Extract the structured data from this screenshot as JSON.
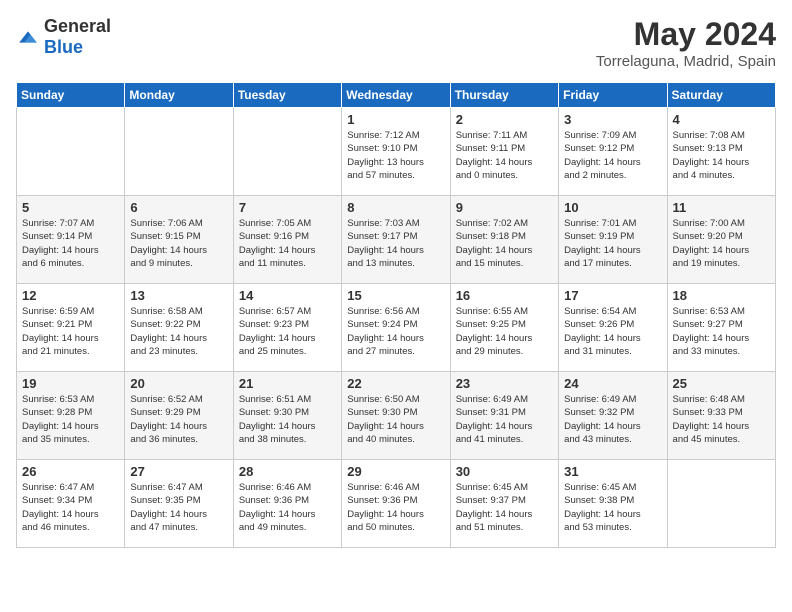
{
  "header": {
    "logo_general": "General",
    "logo_blue": "Blue",
    "month": "May 2024",
    "location": "Torrelaguna, Madrid, Spain"
  },
  "days_of_week": [
    "Sunday",
    "Monday",
    "Tuesday",
    "Wednesday",
    "Thursday",
    "Friday",
    "Saturday"
  ],
  "weeks": [
    [
      {
        "day": "",
        "info": ""
      },
      {
        "day": "",
        "info": ""
      },
      {
        "day": "",
        "info": ""
      },
      {
        "day": "1",
        "info": "Sunrise: 7:12 AM\nSunset: 9:10 PM\nDaylight: 13 hours\nand 57 minutes."
      },
      {
        "day": "2",
        "info": "Sunrise: 7:11 AM\nSunset: 9:11 PM\nDaylight: 14 hours\nand 0 minutes."
      },
      {
        "day": "3",
        "info": "Sunrise: 7:09 AM\nSunset: 9:12 PM\nDaylight: 14 hours\nand 2 minutes."
      },
      {
        "day": "4",
        "info": "Sunrise: 7:08 AM\nSunset: 9:13 PM\nDaylight: 14 hours\nand 4 minutes."
      }
    ],
    [
      {
        "day": "5",
        "info": "Sunrise: 7:07 AM\nSunset: 9:14 PM\nDaylight: 14 hours\nand 6 minutes."
      },
      {
        "day": "6",
        "info": "Sunrise: 7:06 AM\nSunset: 9:15 PM\nDaylight: 14 hours\nand 9 minutes."
      },
      {
        "day": "7",
        "info": "Sunrise: 7:05 AM\nSunset: 9:16 PM\nDaylight: 14 hours\nand 11 minutes."
      },
      {
        "day": "8",
        "info": "Sunrise: 7:03 AM\nSunset: 9:17 PM\nDaylight: 14 hours\nand 13 minutes."
      },
      {
        "day": "9",
        "info": "Sunrise: 7:02 AM\nSunset: 9:18 PM\nDaylight: 14 hours\nand 15 minutes."
      },
      {
        "day": "10",
        "info": "Sunrise: 7:01 AM\nSunset: 9:19 PM\nDaylight: 14 hours\nand 17 minutes."
      },
      {
        "day": "11",
        "info": "Sunrise: 7:00 AM\nSunset: 9:20 PM\nDaylight: 14 hours\nand 19 minutes."
      }
    ],
    [
      {
        "day": "12",
        "info": "Sunrise: 6:59 AM\nSunset: 9:21 PM\nDaylight: 14 hours\nand 21 minutes."
      },
      {
        "day": "13",
        "info": "Sunrise: 6:58 AM\nSunset: 9:22 PM\nDaylight: 14 hours\nand 23 minutes."
      },
      {
        "day": "14",
        "info": "Sunrise: 6:57 AM\nSunset: 9:23 PM\nDaylight: 14 hours\nand 25 minutes."
      },
      {
        "day": "15",
        "info": "Sunrise: 6:56 AM\nSunset: 9:24 PM\nDaylight: 14 hours\nand 27 minutes."
      },
      {
        "day": "16",
        "info": "Sunrise: 6:55 AM\nSunset: 9:25 PM\nDaylight: 14 hours\nand 29 minutes."
      },
      {
        "day": "17",
        "info": "Sunrise: 6:54 AM\nSunset: 9:26 PM\nDaylight: 14 hours\nand 31 minutes."
      },
      {
        "day": "18",
        "info": "Sunrise: 6:53 AM\nSunset: 9:27 PM\nDaylight: 14 hours\nand 33 minutes."
      }
    ],
    [
      {
        "day": "19",
        "info": "Sunrise: 6:53 AM\nSunset: 9:28 PM\nDaylight: 14 hours\nand 35 minutes."
      },
      {
        "day": "20",
        "info": "Sunrise: 6:52 AM\nSunset: 9:29 PM\nDaylight: 14 hours\nand 36 minutes."
      },
      {
        "day": "21",
        "info": "Sunrise: 6:51 AM\nSunset: 9:30 PM\nDaylight: 14 hours\nand 38 minutes."
      },
      {
        "day": "22",
        "info": "Sunrise: 6:50 AM\nSunset: 9:30 PM\nDaylight: 14 hours\nand 40 minutes."
      },
      {
        "day": "23",
        "info": "Sunrise: 6:49 AM\nSunset: 9:31 PM\nDaylight: 14 hours\nand 41 minutes."
      },
      {
        "day": "24",
        "info": "Sunrise: 6:49 AM\nSunset: 9:32 PM\nDaylight: 14 hours\nand 43 minutes."
      },
      {
        "day": "25",
        "info": "Sunrise: 6:48 AM\nSunset: 9:33 PM\nDaylight: 14 hours\nand 45 minutes."
      }
    ],
    [
      {
        "day": "26",
        "info": "Sunrise: 6:47 AM\nSunset: 9:34 PM\nDaylight: 14 hours\nand 46 minutes."
      },
      {
        "day": "27",
        "info": "Sunrise: 6:47 AM\nSunset: 9:35 PM\nDaylight: 14 hours\nand 47 minutes."
      },
      {
        "day": "28",
        "info": "Sunrise: 6:46 AM\nSunset: 9:36 PM\nDaylight: 14 hours\nand 49 minutes."
      },
      {
        "day": "29",
        "info": "Sunrise: 6:46 AM\nSunset: 9:36 PM\nDaylight: 14 hours\nand 50 minutes."
      },
      {
        "day": "30",
        "info": "Sunrise: 6:45 AM\nSunset: 9:37 PM\nDaylight: 14 hours\nand 51 minutes."
      },
      {
        "day": "31",
        "info": "Sunrise: 6:45 AM\nSunset: 9:38 PM\nDaylight: 14 hours\nand 53 minutes."
      },
      {
        "day": "",
        "info": ""
      }
    ]
  ]
}
